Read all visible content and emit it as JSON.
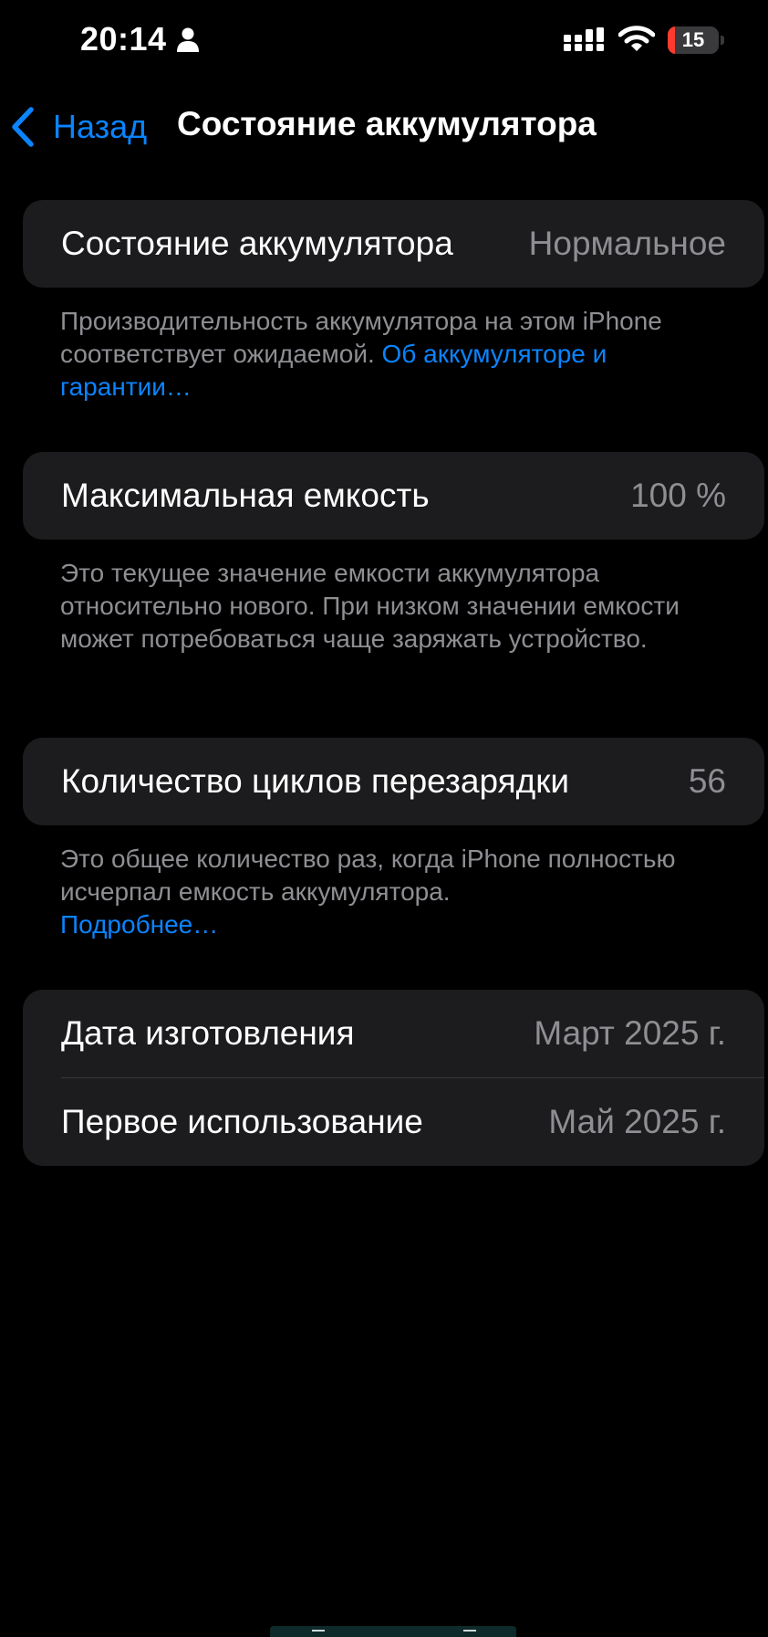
{
  "status_bar": {
    "time": "20:14",
    "battery_percent": "15",
    "battery_level": 0.15,
    "battery_color": "#ff3b30",
    "icons": [
      "person-icon",
      "cellular-signal-icon",
      "wifi-icon",
      "battery-icon"
    ]
  },
  "nav": {
    "back_label": "Назад",
    "title": "Состояние аккумулятора",
    "accent_color": "#0a84ff"
  },
  "sections": {
    "health": {
      "label": "Состояние аккумулятора",
      "value": "Нормальное",
      "footnote_text": "Производительность аккумулятора на этом iPhone соответствует ожидаемой. ",
      "footnote_link": "Об аккумуля­торе и гарантии…"
    },
    "capacity": {
      "label": "Максимальная емкость",
      "value": "100 %",
      "footnote_text": "Это текущее значение емкости аккумулятора относительно нового. При низком значении емкости может потребоваться чаще заряжать устройство."
    },
    "cycles": {
      "label": "Количество циклов перезарядки",
      "value": "56",
      "footnote_text": "Это общее количество раз, когда iPhone полностью исчерпал емкость аккумулятора.",
      "footnote_link": "Подробнее…"
    },
    "dates": {
      "manufacture_label": "Дата изготовления",
      "manufacture_value": "Март 2025 г.",
      "first_use_label": "Первое использование",
      "first_use_value": "Май 2025 г."
    }
  }
}
